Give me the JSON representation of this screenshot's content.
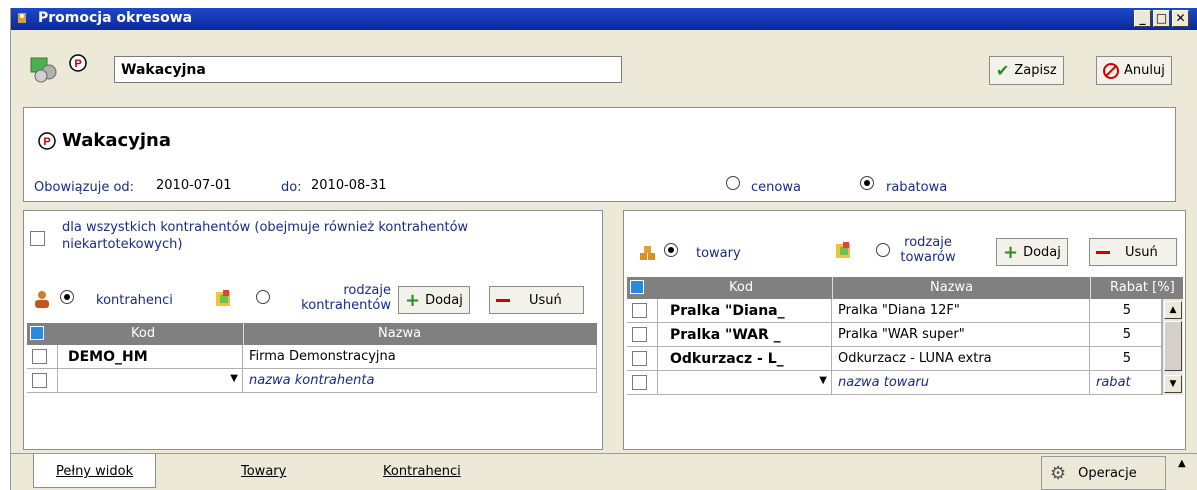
{
  "window": {
    "title": "Promocja okresowa"
  },
  "toolbar": {
    "name_value": "Wakacyjna",
    "save_label": "Zapisz",
    "cancel_label": "Anuluj"
  },
  "header": {
    "title": "Wakacyjna",
    "valid_from_label": "Obowiązuje od:",
    "valid_from": "2010-07-01",
    "valid_to_label": "do:",
    "valid_to": "2010-08-31",
    "type_price": "cenowa",
    "type_discount": "rabatowa"
  },
  "left": {
    "all_contractors": "dla wszystkich kontrahentów (obejmuje również kontrahentów niekartotekowych)",
    "radio_contractors": "kontrahenci",
    "radio_types": "rodzaje kontrahentów",
    "add": "Dodaj",
    "remove": "Usuń",
    "columns": [
      "Kod",
      "Nazwa"
    ],
    "rows": [
      {
        "code": "DEMO_HM",
        "name": "Firma Demonstracyjna"
      }
    ],
    "new_row_placeholder": "nazwa kontrahenta"
  },
  "right": {
    "radio_goods": "towary",
    "radio_types": "rodzaje towarów",
    "add": "Dodaj",
    "remove": "Usuń",
    "columns": [
      "Kod",
      "Nazwa",
      "Rabat [%]"
    ],
    "rows": [
      {
        "code": "Pralka \"Diana_",
        "name": "Pralka \"Diana 12F\"",
        "discount": "5"
      },
      {
        "code": "Pralka \"WAR _",
        "name": "Pralka \"WAR super\"",
        "discount": "5"
      },
      {
        "code": "Odkurzacz - L_",
        "name": "Odkurzacz - LUNA extra",
        "discount": "5"
      }
    ],
    "new_row_placeholder": "nazwa towaru",
    "new_row_discount": "rabat"
  },
  "footer": {
    "tabs": [
      "Pełny widok",
      "Towary",
      "Kontrahenci"
    ],
    "operations": "Operacje"
  }
}
